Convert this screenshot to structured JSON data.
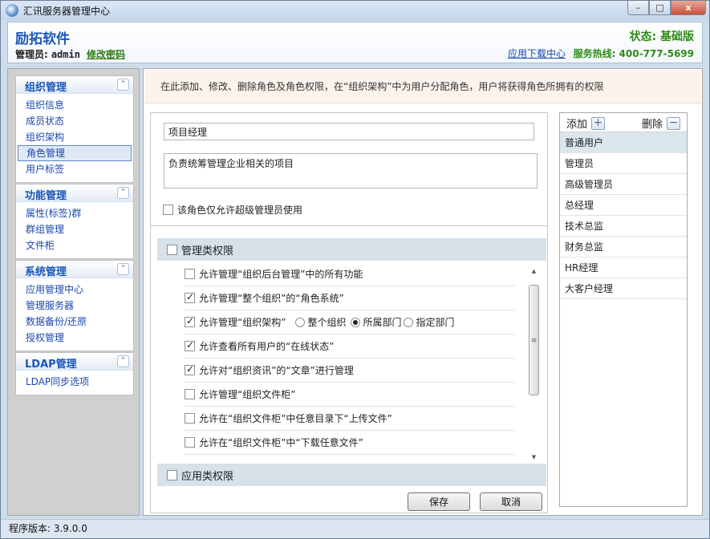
{
  "window": {
    "title": "汇讯服务器管理中心",
    "controls": [
      "–",
      "□",
      "x"
    ]
  },
  "header": {
    "brand": "励拓软件",
    "admin_label": "管理员:",
    "admin_name": "admin",
    "change_password": "修改密码",
    "status": "状态: 基础版",
    "download_center": "应用下载中心",
    "hotline": "服务热线: 400-777-5699"
  },
  "sidebar": {
    "groups": [
      {
        "title": "组织管理",
        "items": [
          "组织信息",
          "成员状态",
          "组织架构",
          "角色管理",
          "用户标签"
        ]
      },
      {
        "title": "功能管理",
        "items": [
          "属性(标签)群",
          "群组管理",
          "文件柜"
        ]
      },
      {
        "title": "系统管理",
        "items": [
          "应用管理中心",
          "管理服务器",
          "数据备份/还原",
          "授权管理"
        ]
      },
      {
        "title": "LDAP管理",
        "items": [
          "LDAP同步选项"
        ]
      }
    ],
    "active_item": "角色管理"
  },
  "notice": "在此添加、修改、删除角色及角色权限，在“组织架构”中为用户分配角色，用户将获得角色所拥有的权限",
  "form": {
    "role_name": "项目经理",
    "role_description": "负责统筹管理企业相关的项目",
    "super_admin_only": {
      "label": "该角色仅允许超级管理员使用",
      "checked": false
    },
    "management_section": {
      "label": "管理类权限",
      "checked": false
    },
    "permissions": [
      {
        "label": "允许管理“组织后台管理”中的所有功能",
        "checked": false
      },
      {
        "label": "允许管理“整个组织”的“角色系统”",
        "checked": true
      },
      {
        "label": "允许管理“组织架构”",
        "checked": true,
        "options": [
          {
            "label": "整个组织",
            "selected": false
          },
          {
            "label": "所属部门",
            "selected": true
          },
          {
            "label": "指定部门",
            "selected": false
          }
        ]
      },
      {
        "label": "允许查看所有用户的“在线状态”",
        "checked": true
      },
      {
        "label": "允许对“组织资讯”的“文章”进行管理",
        "checked": true
      },
      {
        "label": "允许管理“组织文件柜”",
        "checked": false
      },
      {
        "label": "允许在“组织文件柜”中任意目录下“上传文件”",
        "checked": false
      },
      {
        "label": "允许在“组织文件柜”中“下载任意文件”",
        "checked": false
      }
    ],
    "app_section": {
      "label": "应用类权限",
      "checked": false
    },
    "save_label": "保存",
    "cancel_label": "取消"
  },
  "roles": {
    "add_label": "添加",
    "delete_label": "删除",
    "items": [
      "普通用户",
      "管理员",
      "高级管理员",
      "总经理",
      "技术总监",
      "财务总监",
      "HR经理",
      "大客户经理"
    ],
    "selected": "普通用户"
  },
  "footer": {
    "version": "程序版本: 3.9.0.0"
  }
}
